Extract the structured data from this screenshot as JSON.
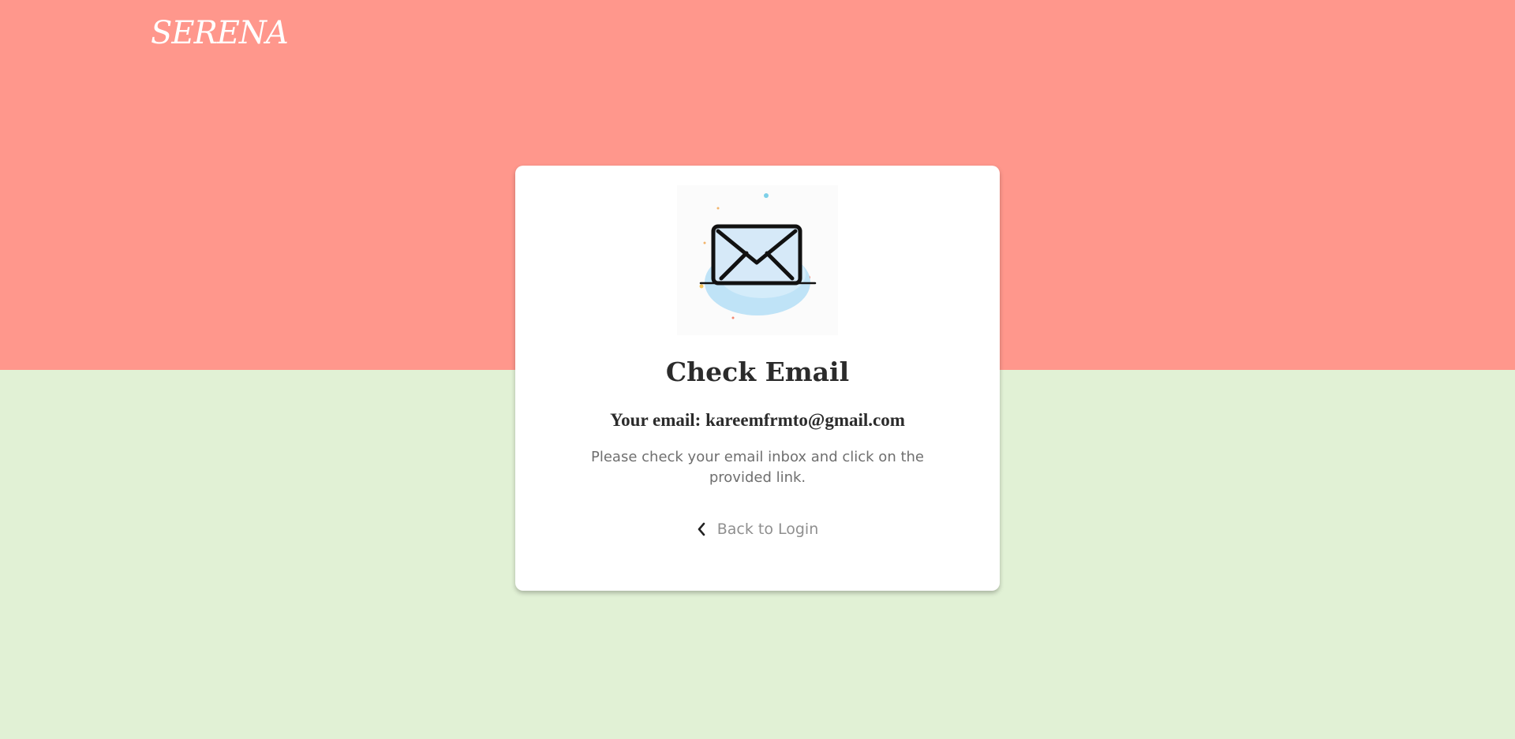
{
  "brand": {
    "logo_text": "SERENA"
  },
  "colors": {
    "top_background": "#ff978c",
    "bottom_background": "#e1f1d5",
    "card_background": "#ffffff",
    "title_color": "#2b2b2b",
    "body_text_color": "#6f6f6f",
    "link_color": "#8f8f8f"
  },
  "card": {
    "illustration_icon": "envelope-icon",
    "title": "Check Email",
    "email_line": "Your email: kareemfrmto@gmail.com",
    "message": "Please check your email inbox and click on the provided link.",
    "back_link": {
      "icon": "chevron-left-icon",
      "label": "Back to Login"
    }
  }
}
